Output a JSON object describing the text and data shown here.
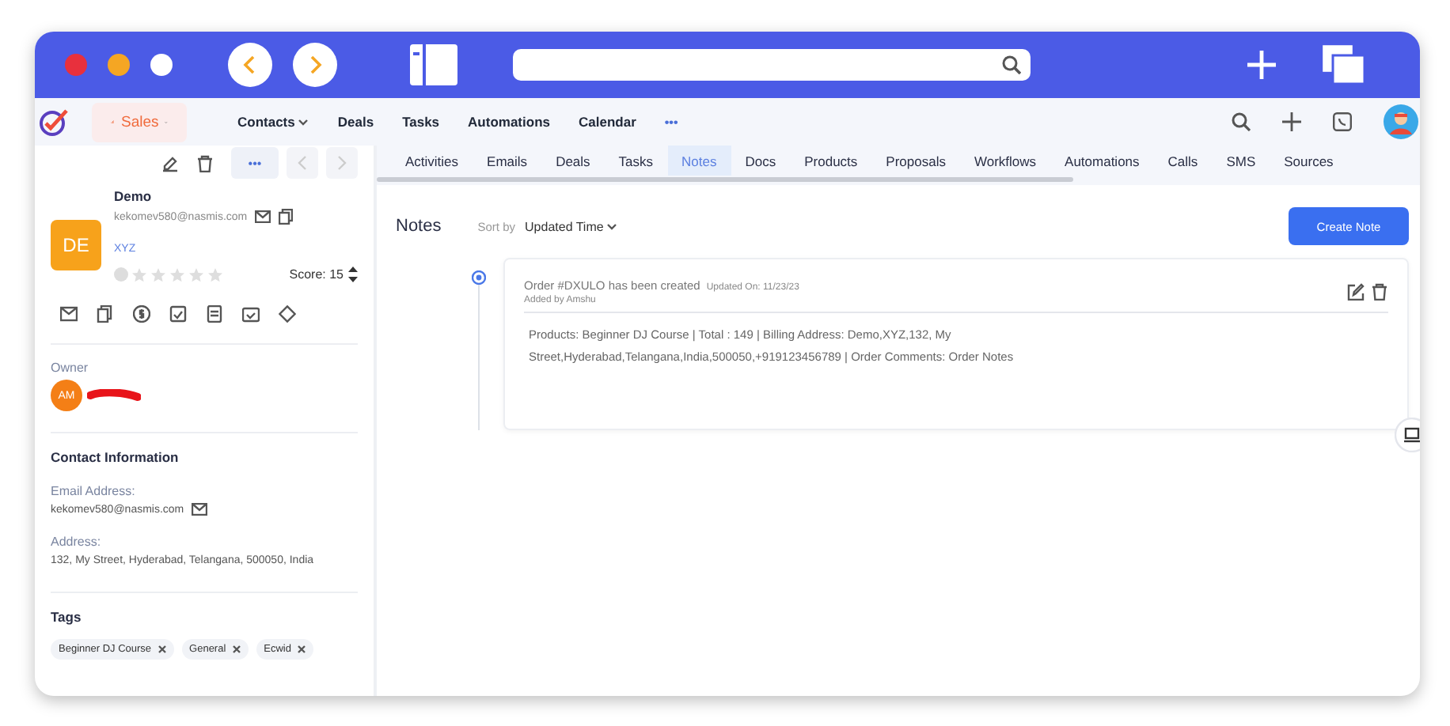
{
  "nav": {
    "app": "Sales",
    "items": [
      "Contacts",
      "Deals",
      "Tasks",
      "Automations",
      "Calendar",
      "•••"
    ]
  },
  "contact": {
    "name": "Demo",
    "initials": "DE",
    "email": "kekomev580@nasmis.com",
    "company": "XYZ",
    "stars": 0,
    "score": "Score: 15",
    "more": "•••"
  },
  "owner": {
    "label": "Owner",
    "initials": "AM"
  },
  "info": {
    "title": "Contact Information",
    "email_label": "Email Address:",
    "email": "kekomev580@nasmis.com",
    "address_label": "Address:",
    "address": "132, My Street, Hyderabad, Telangana, 500050, India"
  },
  "tags": {
    "title": "Tags",
    "items": [
      "Beginner DJ Course",
      "General",
      "Ecwid"
    ]
  },
  "tabs": [
    {
      "label": "Activities",
      "selected": false
    },
    {
      "label": "Emails",
      "selected": false
    },
    {
      "label": "Deals",
      "selected": false
    },
    {
      "label": "Tasks",
      "selected": false
    },
    {
      "label": "Notes",
      "selected": true
    },
    {
      "label": "Docs",
      "selected": false
    },
    {
      "label": "Products",
      "selected": false
    },
    {
      "label": "Proposals",
      "selected": false
    },
    {
      "label": "Workflows",
      "selected": false
    },
    {
      "label": "Automations",
      "selected": false
    },
    {
      "label": "Calls",
      "selected": false
    },
    {
      "label": "SMS",
      "selected": false
    },
    {
      "label": "Sources",
      "selected": false
    }
  ],
  "notes": {
    "title": "Notes",
    "sort_label": "Sort by",
    "sort_value": "Updated Time",
    "create": "Create Note",
    "items": [
      {
        "title": "Order #DXULO has been created",
        "updated": "Updated On: 11/23/23",
        "author": "Added by Amshu",
        "body": "Products: Beginner DJ Course | Total : 149 | Billing Address: Demo,XYZ,132, My Street,Hyderabad,Telangana,India,500050,+919123456789 | Order Comments: Order Notes"
      }
    ]
  }
}
